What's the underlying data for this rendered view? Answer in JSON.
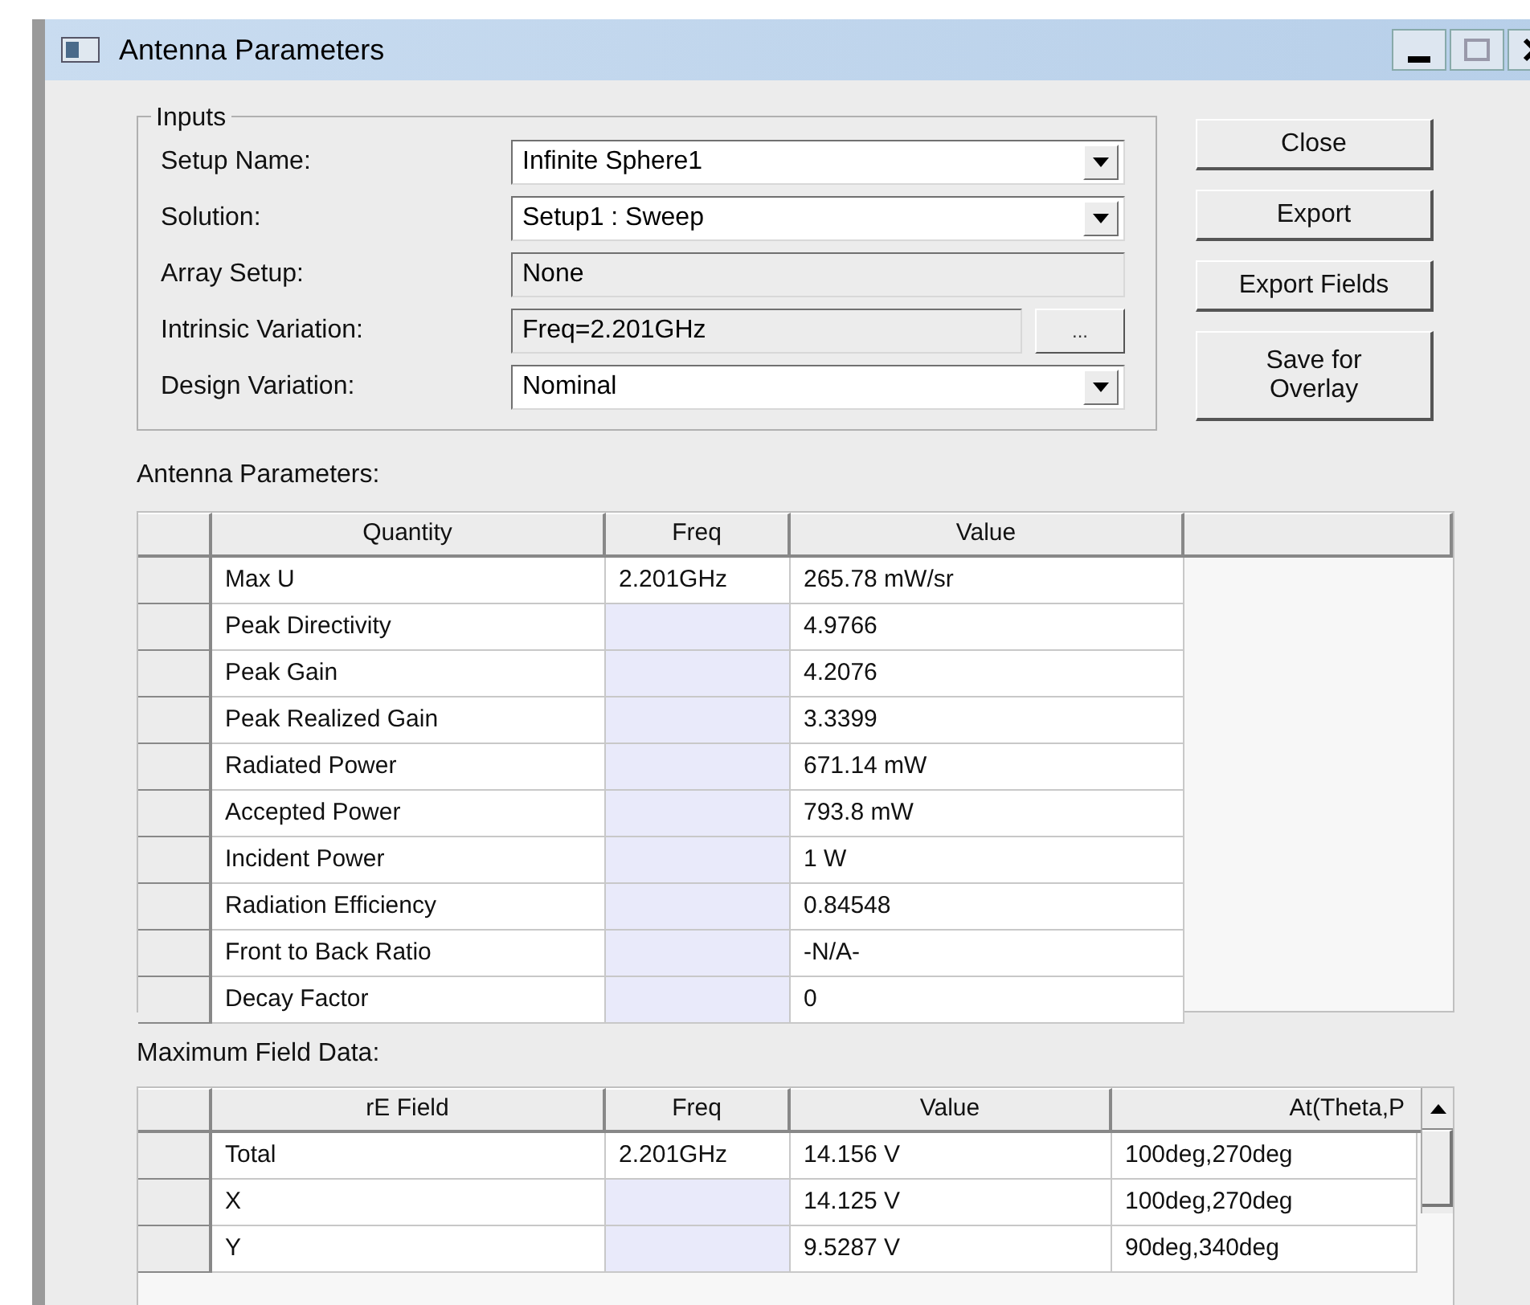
{
  "window": {
    "title": "Antenna Parameters"
  },
  "inputs": {
    "title": "Inputs",
    "fields": [
      {
        "label": "Setup Name:",
        "value": "Infinite Sphere1",
        "kind": "combo"
      },
      {
        "label": "Solution:",
        "value": "Setup1 : Sweep",
        "kind": "combo"
      },
      {
        "label": "Array Setup:",
        "value": "None",
        "kind": "readonly"
      },
      {
        "label": "Intrinsic Variation:",
        "value": "Freq=2.201GHz",
        "kind": "browse",
        "button": "..."
      },
      {
        "label": "Design Variation:",
        "value": "Nominal",
        "kind": "combo"
      }
    ]
  },
  "buttons": [
    "Close",
    "Export",
    "Export Fields",
    "Save for Overlay"
  ],
  "antenna_parameters": {
    "label": "Antenna Parameters:",
    "columns": [
      "Quantity",
      "Freq",
      "Value"
    ],
    "rows": [
      {
        "quantity": "Max U",
        "freq": "2.201GHz",
        "value": "265.78 mW/sr"
      },
      {
        "quantity": "Peak Directivity",
        "value": "4.9766"
      },
      {
        "quantity": "Peak Gain",
        "value": "4.2076"
      },
      {
        "quantity": "Peak Realized Gain",
        "value": "3.3399"
      },
      {
        "quantity": "Radiated Power",
        "value": "671.14 mW"
      },
      {
        "quantity": "Accepted Power",
        "value": "793.8 mW"
      },
      {
        "quantity": "Incident Power",
        "value": "1 W"
      },
      {
        "quantity": "Radiation Efficiency",
        "value": "0.84548"
      },
      {
        "quantity": "Front to Back Ratio",
        "value": "-N/A-"
      },
      {
        "quantity": "Decay Factor",
        "value": "0"
      }
    ]
  },
  "maximum_field_data": {
    "label": "Maximum Field Data:",
    "columns": [
      "rE Field",
      "Freq",
      "Value",
      "At(Theta,P"
    ],
    "rows": [
      {
        "field": "Total",
        "freq": "2.201GHz",
        "value": "14.156 V",
        "at": "100deg,270deg"
      },
      {
        "field": "X",
        "value": "14.125 V",
        "at": "100deg,270deg"
      },
      {
        "field": "Y",
        "value": "9.5287 V",
        "at": "90deg,340deg"
      }
    ]
  }
}
